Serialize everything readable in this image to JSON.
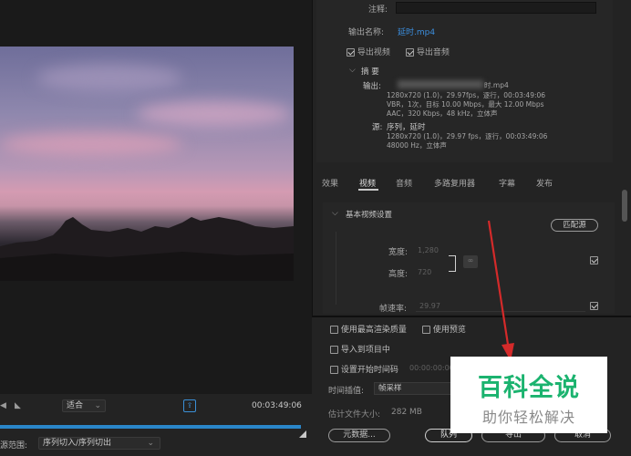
{
  "preview": {
    "fit_value": "适合",
    "timecode": "00:03:49:06",
    "source_range_label": "源范围:",
    "source_range_value": "序列切入/序列切出"
  },
  "export": {
    "comment_label": "注释:",
    "output_name_label": "输出名称:",
    "output_name_value": "延时.mp4",
    "export_video_label": "导出视频",
    "export_audio_label": "导出音频",
    "export_video_checked": true,
    "export_audio_checked": true
  },
  "summary": {
    "title": "摘 要",
    "output_label": "输出:",
    "output_file_suffix": "时.mp4",
    "output_line1": "1280x720 (1.0)，29.97fps，逐行，00:03:49:06",
    "output_line2": "VBR，1次，目标 10.00 Mbps，最大 12.00 Mbps",
    "output_line3": "AAC，320 Kbps，48  kHz，立体声",
    "source_label": "源:",
    "source_name": "序列，延时",
    "source_line1": "1280x720 (1.0)，29.97 fps，逐行，00:03:49:06",
    "source_line2": "48000 Hz，立体声"
  },
  "tabs": [
    {
      "label": "效果"
    },
    {
      "label": "视频"
    },
    {
      "label": "音频"
    },
    {
      "label": "多路复用器"
    },
    {
      "label": "字幕"
    },
    {
      "label": "发布"
    }
  ],
  "video_settings": {
    "section_title": "基本视频设置",
    "match_source_label": "匹配源",
    "width_label": "宽度:",
    "width_value": "1,280",
    "height_label": "高度:",
    "height_value": "720",
    "framerate_label": "帧速率:",
    "framerate_value": "29.97"
  },
  "options": {
    "max_render_quality": "使用最高渲染质量",
    "use_previews": "使用预览",
    "import_to_project": "导入到项目中",
    "set_start_timecode": "设置开始时间码",
    "start_timecode_value": "00:00:00:00",
    "interpolation_label": "时间插值:",
    "interpolation_value": "帧采样",
    "file_size_label": "估计文件大小:",
    "file_size_value": "282 MB"
  },
  "buttons": {
    "metadata": "元数据...",
    "queue": "队列",
    "export": "导出",
    "cancel": "取消"
  },
  "watermark": {
    "title": "百科全说",
    "subtitle": "助你轻松解决",
    "title_color": "#1bb36f"
  },
  "colors": {
    "accent_blue": "#3b8ede",
    "timeline_blue": "#2a86c9",
    "annotation_red": "#d42a2a"
  }
}
